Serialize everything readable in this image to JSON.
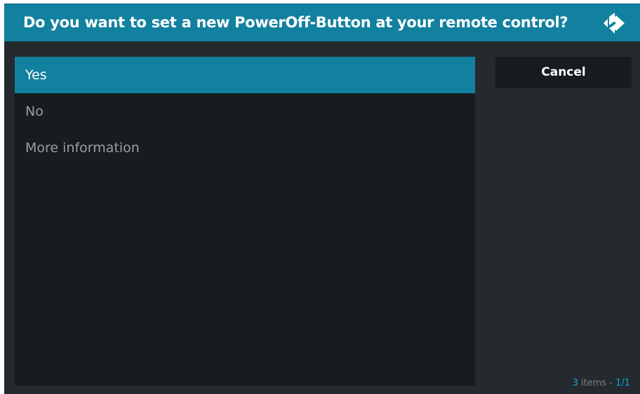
{
  "dialog": {
    "title": "Do you want to set a new PowerOff-Button at your remote control?",
    "logo_icon": "kodi-logo-icon"
  },
  "list": {
    "items": [
      {
        "label": "Yes",
        "selected": true
      },
      {
        "label": "No",
        "selected": false
      },
      {
        "label": "More information",
        "selected": false
      }
    ]
  },
  "side_buttons": {
    "cancel_label": "Cancel"
  },
  "footer": {
    "count": "3",
    "count_label": " items - ",
    "page": "1/1"
  },
  "colors": {
    "accent": "#12809f",
    "panel_background": "#181c1f",
    "dialog_background": "#252a2f",
    "highlight_text": "#12a5d0"
  }
}
